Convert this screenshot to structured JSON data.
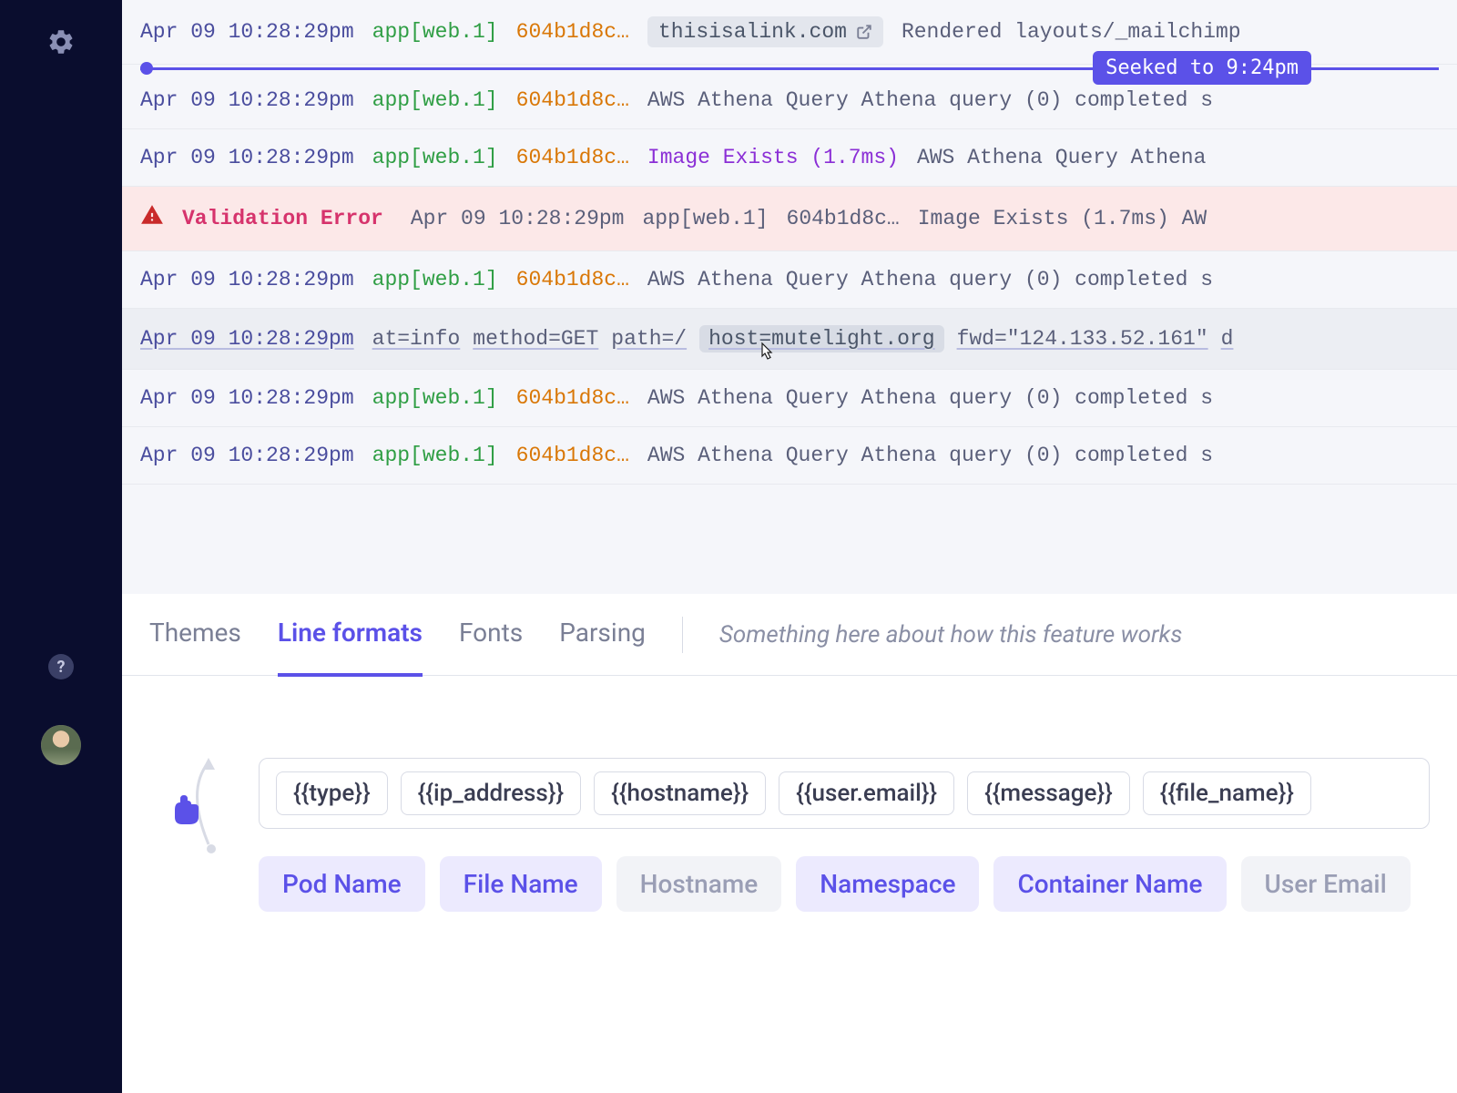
{
  "sidebar": {
    "help_label": "?"
  },
  "seek_badge": "Seeked to 9:24pm",
  "logs": [
    {
      "timestamp": "Apr 09 10:28:29pm",
      "app": "app[web.1]",
      "hash": "604b1d8c…",
      "link": "thisisalink.com",
      "msg": "Rendered layouts/_mailchimp"
    },
    {
      "timestamp": "Apr 09 10:28:29pm",
      "app": "app[web.1]",
      "hash": "604b1d8c…",
      "msg": "AWS Athena Query Athena query (0) completed s"
    },
    {
      "timestamp": "Apr 09 10:28:29pm",
      "app": "app[web.1]",
      "hash": "604b1d8c…",
      "purple": "Image Exists (1.7ms)",
      "msg": "AWS Athena Query Athena"
    },
    {
      "error_label": "Validation Error",
      "timestamp": "Apr 09 10:28:29pm",
      "app": "app[web.1]",
      "hash": "604b1d8c…",
      "msg": "Image Exists (1.7ms)  AW"
    },
    {
      "timestamp": "Apr 09 10:28:29pm",
      "app": "app[web.1]",
      "hash": "604b1d8c…",
      "msg": "AWS Athena Query Athena query (0) completed s"
    },
    {
      "timestamp": "Apr 09 10:28:29pm",
      "kv1": "at=info",
      "kv2": "method=GET",
      "kv3": "path=/",
      "kv_host": "host=mutelight.org",
      "kv4": "fwd=\"124.133.52.161\"",
      "kv5": "d"
    },
    {
      "timestamp": "Apr 09 10:28:29pm",
      "app": "app[web.1]",
      "hash": "604b1d8c…",
      "msg": "AWS Athena Query Athena query (0) completed s"
    },
    {
      "timestamp": "Apr 09 10:28:29pm",
      "app": "app[web.1]",
      "hash": "604b1d8c…",
      "msg": "AWS Athena Query Athena query (0) completed s"
    }
  ],
  "tabs": {
    "themes": "Themes",
    "line_formats": "Line formats",
    "fonts": "Fonts",
    "parsing": "Parsing",
    "hint": "Something here about how this feature works"
  },
  "tokens": [
    "{{type}}",
    "{{ip_address}}",
    "{{hostname}}",
    "{{user.email}}",
    "{{message}}",
    "{{file_name}}"
  ],
  "chips": [
    {
      "label": "Pod Name",
      "state": "available"
    },
    {
      "label": "File Name",
      "state": "available"
    },
    {
      "label": "Hostname",
      "state": "used"
    },
    {
      "label": "Namespace",
      "state": "available"
    },
    {
      "label": "Container Name",
      "state": "available"
    },
    {
      "label": "User Email",
      "state": "used"
    }
  ]
}
